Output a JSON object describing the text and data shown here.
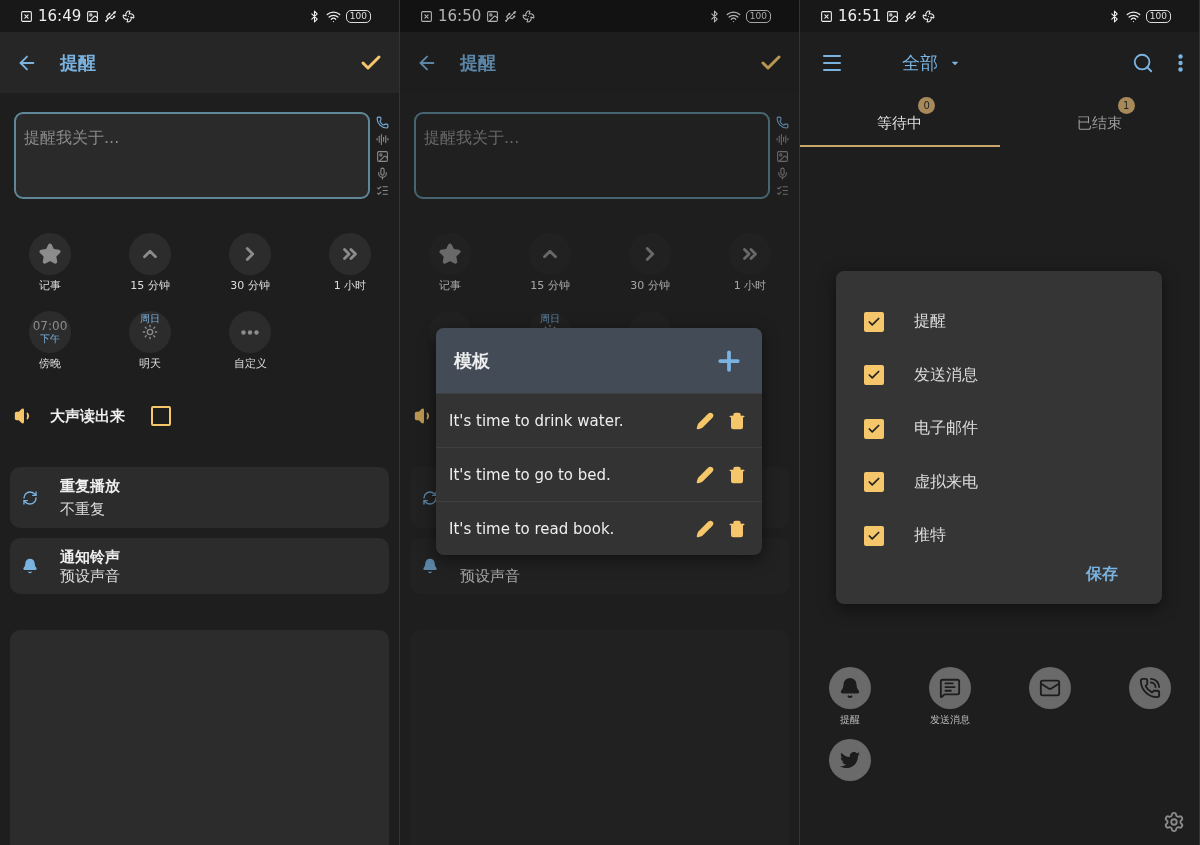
{
  "screens": [
    {
      "kind": "editor",
      "dimmed": false,
      "status_bar": {
        "time": "16:49",
        "battery": "100"
      },
      "header": {
        "title": "提醒"
      },
      "input": {
        "placeholder": "提醒我关于..."
      },
      "quick_actions": [
        {
          "kind": "star",
          "label": "记事"
        },
        {
          "kind": "up",
          "label": "15 分钟"
        },
        {
          "kind": "right",
          "label": "30 分钟"
        },
        {
          "kind": "double",
          "label": "1 小时"
        },
        {
          "kind": "time",
          "time": "07:00",
          "period": "下午",
          "label": "傍晚"
        },
        {
          "kind": "weather",
          "day": "周日",
          "label": "明天"
        },
        {
          "kind": "more",
          "label": "自定义"
        }
      ],
      "read_aloud": {
        "label": "大声读出来",
        "checked": false
      },
      "repeat": {
        "title": "重复播放",
        "value": "不重复"
      },
      "sound": {
        "title": "通知铃声",
        "value": "预设声音"
      }
    },
    {
      "kind": "editor",
      "dimmed": true,
      "status_bar": {
        "time": "16:50",
        "battery": "100"
      },
      "header": {
        "title": "提醒"
      },
      "input": {
        "placeholder": "提醒我关于..."
      },
      "quick_actions": [
        {
          "kind": "star",
          "label": "记事"
        },
        {
          "kind": "up",
          "label": "15 分钟"
        },
        {
          "kind": "right",
          "label": "30 分钟"
        },
        {
          "kind": "double",
          "label": "1 小时"
        },
        {
          "kind": "time"
        },
        {
          "kind": "weather",
          "day": "周日"
        },
        {
          "kind": "more"
        }
      ],
      "sound": {
        "value": "预设声音"
      },
      "dialog": {
        "title": "模板",
        "templates": [
          "It's time to drink water.",
          "It's time to go to bed.",
          "It's time to read book."
        ]
      }
    },
    {
      "kind": "list",
      "status_bar": {
        "time": "16:51",
        "battery": "100"
      },
      "header": {
        "title": "全部"
      },
      "tabs": [
        {
          "label": "等待中",
          "count": "0",
          "selected": true
        },
        {
          "label": "已结束",
          "count": "1",
          "selected": false
        }
      ],
      "filter_dialog": {
        "items": [
          {
            "label": "提醒",
            "checked": true
          },
          {
            "label": "发送消息",
            "checked": true
          },
          {
            "label": "电子邮件",
            "checked": true
          },
          {
            "label": "虚拟来电",
            "checked": true
          },
          {
            "label": "推特",
            "checked": true
          }
        ],
        "save": "保存"
      },
      "categories": [
        {
          "kind": "bell",
          "label": "提醒"
        },
        {
          "kind": "message",
          "label": "发送消息"
        },
        {
          "kind": "mail"
        },
        {
          "kind": "call"
        },
        {
          "kind": "bird"
        }
      ]
    }
  ]
}
